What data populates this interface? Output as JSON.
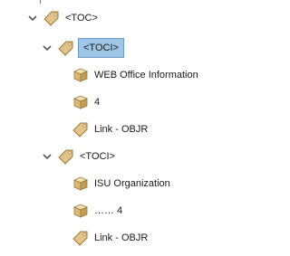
{
  "tree": {
    "root": {
      "label": "<TOC>"
    },
    "toci_1": {
      "label": "<TOCI>",
      "children": [
        {
          "label": "WEB Office Information"
        },
        {
          "label": "4"
        },
        {
          "label": "Link - OBJR"
        }
      ]
    },
    "toci_2": {
      "label": "<TOCI>",
      "children": [
        {
          "label": "ISU Organization"
        },
        {
          "label": "…… 4"
        },
        {
          "label": "Link - OBJR"
        }
      ]
    }
  },
  "colors": {
    "tag_fill": "#e2c48a",
    "tag_stroke": "#9c7a3c",
    "selection": "#9fc6e6",
    "chevron": "#555555"
  }
}
